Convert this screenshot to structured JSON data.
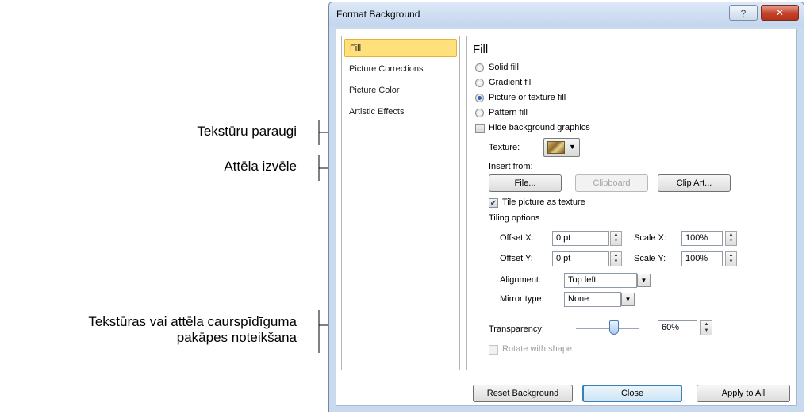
{
  "annotations": {
    "texture_samples": "Tekstūru paraugi",
    "image_selection": "Attēla izvēle",
    "transparency_line1": "Tekstūras vai attēla caurspīdīguma",
    "transparency_line2": "pakāpes noteikšana"
  },
  "window": {
    "title": "Format Background",
    "help_icon": "question-mark",
    "close_icon": "x"
  },
  "nav": {
    "items": [
      {
        "label": "Fill",
        "selected": true
      },
      {
        "label": "Picture Corrections",
        "selected": false
      },
      {
        "label": "Picture Color",
        "selected": false
      },
      {
        "label": "Artistic Effects",
        "selected": false
      }
    ]
  },
  "fill": {
    "heading": "Fill",
    "options": [
      {
        "label": "Solid fill",
        "selected": false
      },
      {
        "label": "Gradient fill",
        "selected": false
      },
      {
        "label": "Picture or texture fill",
        "selected": true
      },
      {
        "label": "Pattern fill",
        "selected": false
      }
    ],
    "hide_bg_label": "Hide background graphics",
    "hide_bg_checked": false,
    "texture_label": "Texture:",
    "insert_from_label": "Insert from:",
    "file_button": "File...",
    "clipboard_button": "Clipboard",
    "clipart_button": "Clip Art...",
    "tile_label": "Tile picture as texture",
    "tile_checked": true,
    "tiling_options_label": "Tiling options",
    "offset_x_label": "Offset X:",
    "offset_x_value": "0 pt",
    "offset_y_label": "Offset Y:",
    "offset_y_value": "0 pt",
    "scale_x_label": "Scale X:",
    "scale_x_value": "100%",
    "scale_y_label": "Scale Y:",
    "scale_y_value": "100%",
    "alignment_label": "Alignment:",
    "alignment_value": "Top left",
    "mirror_label": "Mirror type:",
    "mirror_value": "None",
    "transparency_label": "Transparency:",
    "transparency_value": "60%",
    "transparency_fraction": 0.6,
    "rotate_label": "Rotate with shape",
    "rotate_checked": false
  },
  "footer": {
    "reset_button": "Reset Background",
    "close_button": "Close",
    "apply_all_button": "Apply to All"
  }
}
